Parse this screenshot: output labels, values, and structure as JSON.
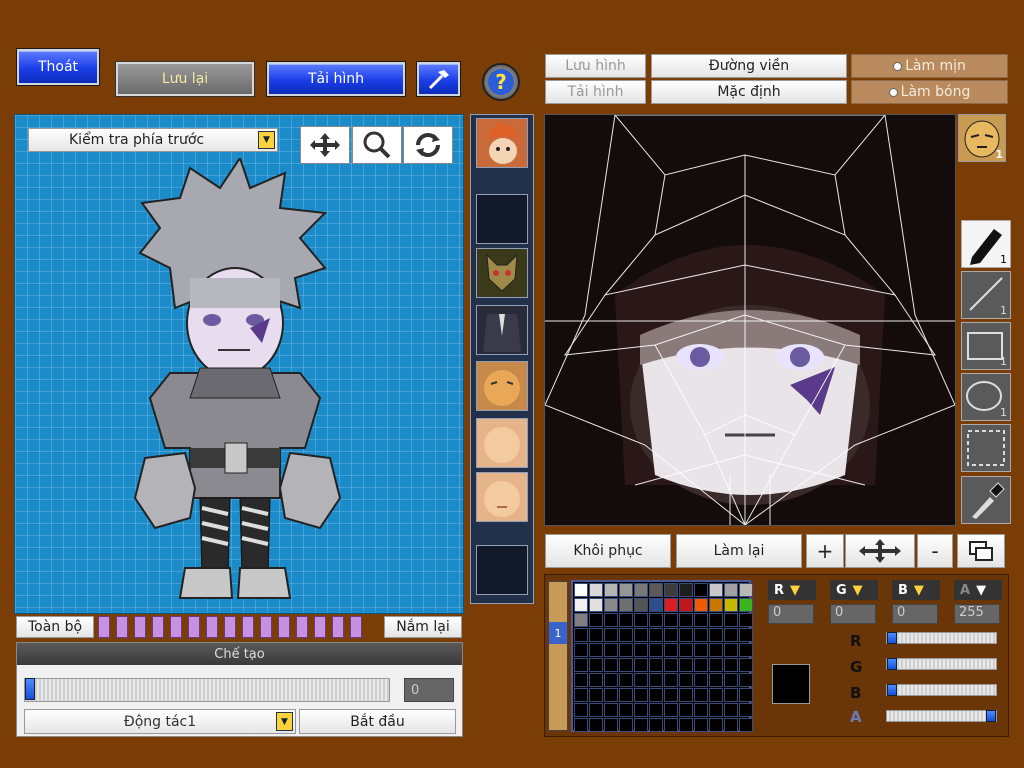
{
  "top": {
    "exit_label": "Thoát",
    "save_label": "Lưu lại",
    "load_label": "Tải hình",
    "help_icon": "question-icon",
    "hammer_icon": "hammer-icon"
  },
  "right_top": {
    "save_image_label": "Lưu hình",
    "load_image_label": "Tải hình",
    "outline_label": "Đường viền",
    "default_label": "Mặc định",
    "smooth_label": "Làm mịn",
    "shade_label": "Làm bóng"
  },
  "preview": {
    "view_select": "Kiểm tra phía trước",
    "move_icon": "move-icon",
    "zoom_icon": "magnifier-icon",
    "rotate_icon": "rotate-icon",
    "all_label": "Toàn bộ",
    "grab_label": "Nắm lại"
  },
  "create": {
    "title": "Chế tạo",
    "progress_value": "0",
    "progress": 0,
    "action_select": "Động tác1",
    "start_label": "Bắt đầu"
  },
  "editor": {
    "restore_label": "Khôi phục",
    "redo_label": "Làm lại",
    "plus_label": "+",
    "minus_label": "-"
  },
  "tools": {
    "pen_count": "1",
    "line_count": "1",
    "rect_count": "1",
    "ellipse_count": "1",
    "badge_count": "1"
  },
  "color": {
    "r_label": "R",
    "g_label": "G",
    "b_label": "B",
    "a_label": "A",
    "r_value": "0",
    "g_value": "0",
    "b_value": "0",
    "a_value": "255",
    "current": "#000000",
    "swatches": [
      "#ffffff",
      "#d8d8d8",
      "#b4b4b4",
      "#969696",
      "#787878",
      "#5a5a5a",
      "#3c3c3c",
      "#1e1e1e",
      "#000000",
      "#c8c8c8",
      "#a0a0a0",
      "#b8b8b8",
      "#f0f0f0",
      "#e0e0e0",
      "#8a8a8a",
      "#707070",
      "#555555",
      "#2e4f8a",
      "#d81e1e",
      "#c01818",
      "#f05a00",
      "#c87800",
      "#c8b800",
      "#3cb41e",
      "#808080"
    ],
    "palette_tab": "1"
  }
}
